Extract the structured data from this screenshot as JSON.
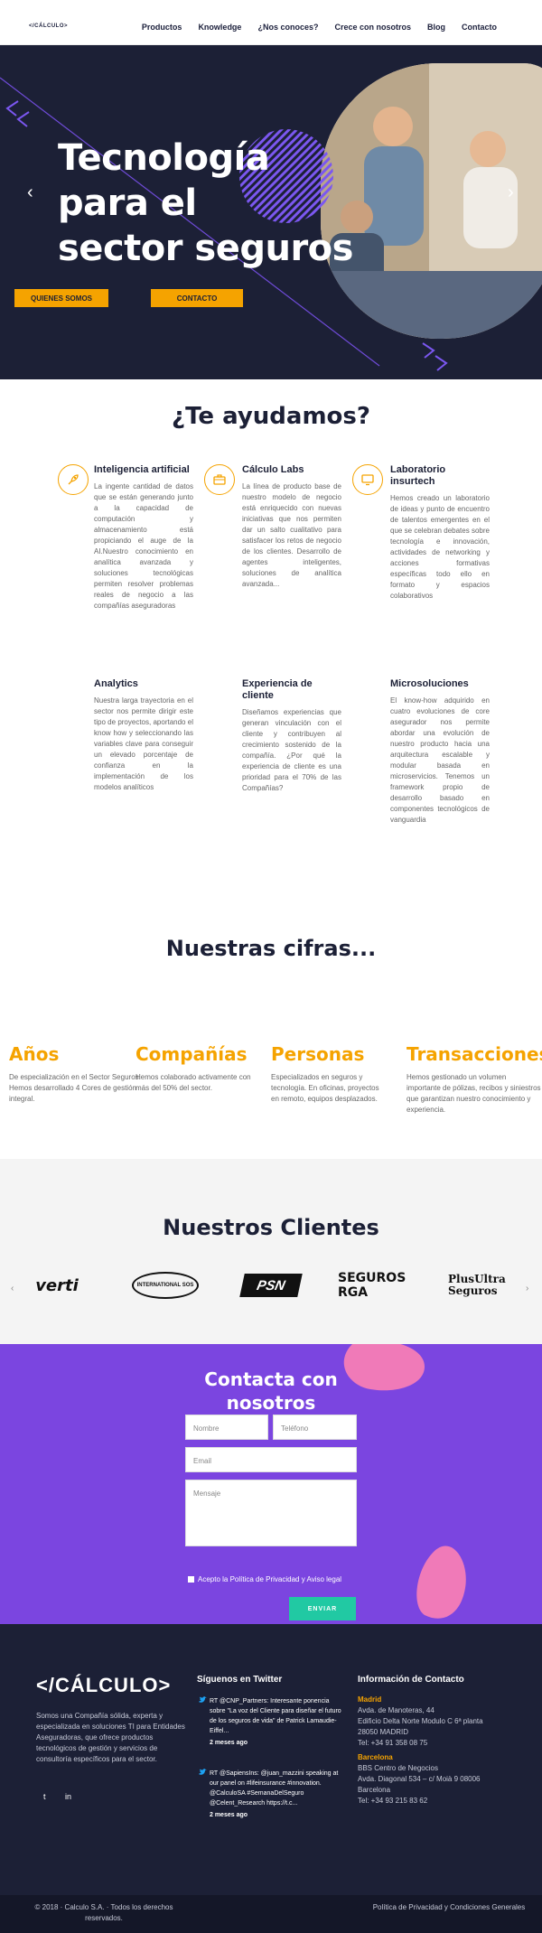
{
  "nav": {
    "logo": "</CÁLCULO>",
    "links": [
      "Productos",
      "Knowledge",
      "¿Nos conoces?",
      "Crece con nosotros",
      "Blog",
      "Contacto"
    ]
  },
  "hero": {
    "title_line1": "Tecnología",
    "title_line2": "para el",
    "title_line3": "sector seguros",
    "btn_about": "QUIENES SOMOS",
    "btn_contact": "CONTACTO",
    "prev": "‹",
    "next": "›"
  },
  "help": {
    "title": "¿Te ayudamos?",
    "services": [
      {
        "title": "Inteligencia artificial",
        "text": "La ingente cantidad de datos que se están generando junto a la capacidad de computación y almacenamiento está propiciando el auge de la AI.Nuestro conocimiento en analítica avanzada y soluciones tecnológicas permiten resolver problemas reales de negocio a las compañías aseguradoras"
      },
      {
        "title": "Cálculo Labs",
        "text": "La línea de producto base de nuestro modelo de negocio está enriquecido con nuevas iniciativas que nos permiten dar un salto cualitativo para satisfacer los retos de negocio de los clientes. Desarrollo de agentes inteligentes, soluciones de analítica avanzada..."
      },
      {
        "title": "Laboratorio insurtech",
        "text": "Hemos creado un laboratorio de ideas y punto de encuentro de talentos emergentes en el que se celebran debates sobre tecnología e innovación, actividades de networking y acciones formativas específicas todo ello en formato y espacios colaborativos"
      },
      {
        "title": "Analytics",
        "text": "Nuestra larga trayectoria en el sector nos permite dirigir este tipo de proyectos, aportando el know how y seleccionando las variables clave para conseguir un elevado porcentaje de confianza en la implementación de los modelos analíticos"
      },
      {
        "title": "Experiencia de cliente",
        "text": "Diseñamos experiencias que generan vinculación con el cliente y contribuyen al crecimiento sostenido de la compañía. ¿Por qué la experiencia de cliente es una prioridad para el 70% de las Compañías?"
      },
      {
        "title": "Microsoluciones",
        "text": "El know-how adquirido en cuatro evoluciones de core asegurador nos permite abordar una evolución de nuestro producto hacia una arquitectura escalable y modular basada en microservicios. Tenemos un framework propio de desarrollo basado en componentes tecnológicos de vanguardia"
      }
    ]
  },
  "figures": {
    "title": "Nuestras cifras...",
    "items": [
      {
        "title": "Años",
        "text": "De especialización en el Sector Seguros. Hemos desarrollado 4 Cores de gestión integral."
      },
      {
        "title": "Compañías",
        "text": "Hemos colaborado activamente con más del 50% del sector."
      },
      {
        "title": "Personas",
        "text": "Especializados en seguros y tecnología. En oficinas, proyectos en remoto, equipos desplazados."
      },
      {
        "title": "Transacciones",
        "text": "Hemos gestionado un volumen importante de pólizas, recibos y siniestros que garantizan nuestro conocimiento y experiencia."
      }
    ]
  },
  "clients": {
    "title": "Nuestros Clientes",
    "logos": [
      "verti",
      "INTERNATIONAL SOS",
      "PSN",
      "SEGUROS RGA",
      "PlusUltra Seguros"
    ],
    "prev": "‹",
    "next": "›"
  },
  "contact": {
    "title_line1": "Contacta con",
    "title_line2": "nosotros",
    "name_placeholder": "Nombre",
    "phone_placeholder": "Teléfono",
    "email_placeholder": "Email",
    "message_placeholder": "Mensaje",
    "consent": "Acepto la Política de Privacidad y Aviso legal",
    "send": "ENVIAR"
  },
  "footer": {
    "logo": "</CÁLCULO>",
    "about": "Somos una Compañía sólida, experta y especializada en soluciones TI para Entidades Aseguradoras, que ofrece productos tecnológicos de gestión y servicios de consultoría específicos para el sector.",
    "social": [
      "t",
      "in"
    ],
    "twitter_heading": "Síguenos en Twitter",
    "tweets": [
      {
        "text": "RT @CNP_Partners: Interesante ponencia sobre \"La voz del Cliente para diseñar el futuro de los seguros de vida\" de Patrick Lamaudie-Eiffel...",
        "time": "2 meses ago"
      },
      {
        "text": "RT @SapiensIns: @juan_mazzini speaking at our panel on #lifeinsurance #innovation. @CalculoSA #SemanaDelSeguro @Celent_Research https://t.c...",
        "time": "2 meses ago"
      }
    ],
    "contact_heading": "Información de Contacto",
    "madrid_label": "Madrid",
    "madrid_lines": [
      "Avda. de Manoteras, 44",
      "Edificio Delta Norte Modulo C 6ª planta",
      "28050 MADRID",
      "Tel: +34 91 358 08 75"
    ],
    "barcelona_label": "Barcelona",
    "barcelona_lines": [
      "BBS Centro de Negocios",
      "Avda. Diagonal 534 – c/ Moià 9 08006 Barcelona",
      "Tel: +34 93 215 83 62"
    ]
  },
  "bottom": {
    "copyright": "© 2018 · Calculo S.A. · Todos los derechos reservados.",
    "legal": "Política de Privacidad y Condiciones Generales"
  }
}
